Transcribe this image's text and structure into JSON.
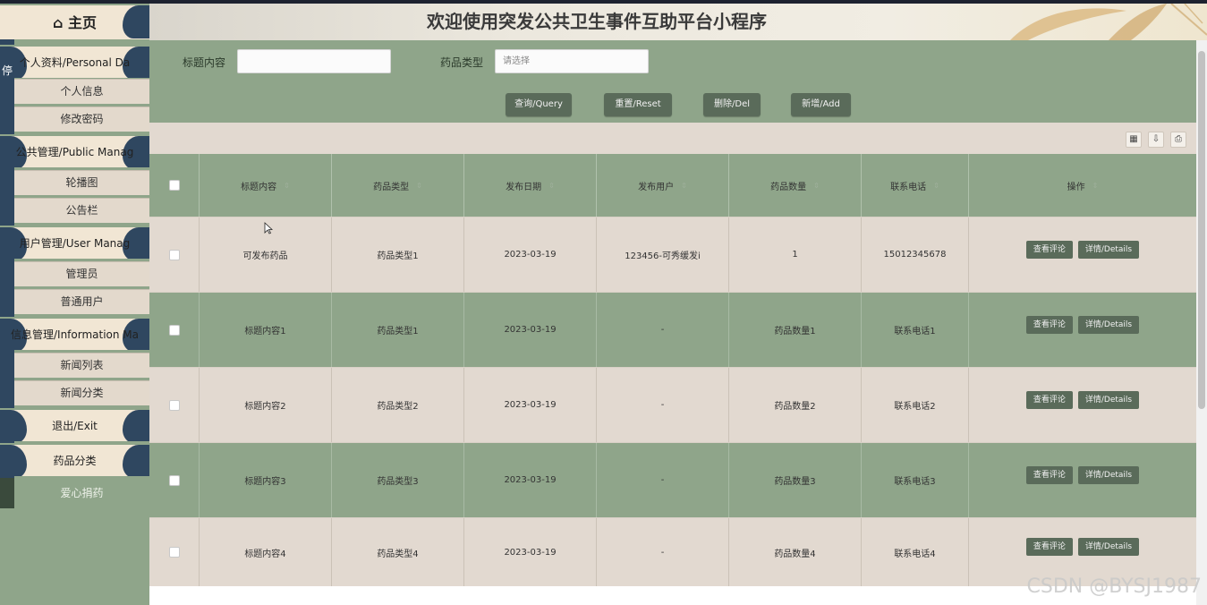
{
  "header": {
    "title": "欢迎使用突发公共卫生事件互助平台小程序"
  },
  "sidebar": {
    "home": "主页",
    "groups": [
      {
        "label": "个人资料/Personal Da",
        "items": [
          "个人信息",
          "修改密码"
        ]
      },
      {
        "label": "公共管理/Public Manag",
        "items": [
          "轮播图",
          "公告栏"
        ]
      },
      {
        "label": "用户管理/User Manag",
        "items": [
          "管理员",
          "普通用户"
        ]
      },
      {
        "label": "信息管理/Information Ma",
        "items": [
          "新闻列表",
          "新闻分类"
        ]
      }
    ],
    "logout": "退出/Exit",
    "medicine_category": "药品分类",
    "donate": "爱心捐药",
    "stray": "停"
  },
  "search": {
    "title_label": "标题内容",
    "title_value": "",
    "type_label": "药品类型",
    "type_placeholder": "请选择",
    "buttons": {
      "query": "查询/Query",
      "reset": "重置/Reset",
      "delete": "删除/Del",
      "add": "新增/Add"
    }
  },
  "table": {
    "columns": [
      "标题内容",
      "药品类型",
      "发布日期",
      "发布用户",
      "药品数量",
      "联系电话",
      "操作"
    ],
    "sort_glyph": "⇕",
    "rows": [
      [
        "可发布药品",
        "药品类型1",
        "2023-03-19",
        "123456-可秀缓发i",
        "1",
        "15012345678"
      ],
      [
        "标题内容1",
        "药品类型1",
        "2023-03-19",
        "-",
        "药品数量1",
        "联系电话1"
      ],
      [
        "标题内容2",
        "药品类型2",
        "2023-03-19",
        "-",
        "药品数量2",
        "联系电话2"
      ],
      [
        "标题内容3",
        "药品类型3",
        "2023-03-19",
        "-",
        "药品数量3",
        "联系电话3"
      ],
      [
        "标题内容4",
        "药品类型4",
        "2023-03-19",
        "-",
        "药品数量4",
        "联系电话4"
      ]
    ],
    "row_actions": {
      "comments": "查看评论",
      "details": "详情/Details"
    }
  },
  "watermark": "CSDN @BYSJ1987",
  "icons": {
    "home": "home-icon",
    "column": "column-toggle-icon",
    "export": "export-icon",
    "print": "print-icon"
  },
  "colors": {
    "sidebar": "#8fa58a",
    "button": "#5a6b5a",
    "row_light": "#e2d9d0",
    "row_green": "#8fa58a",
    "navy": "#2f4760"
  }
}
